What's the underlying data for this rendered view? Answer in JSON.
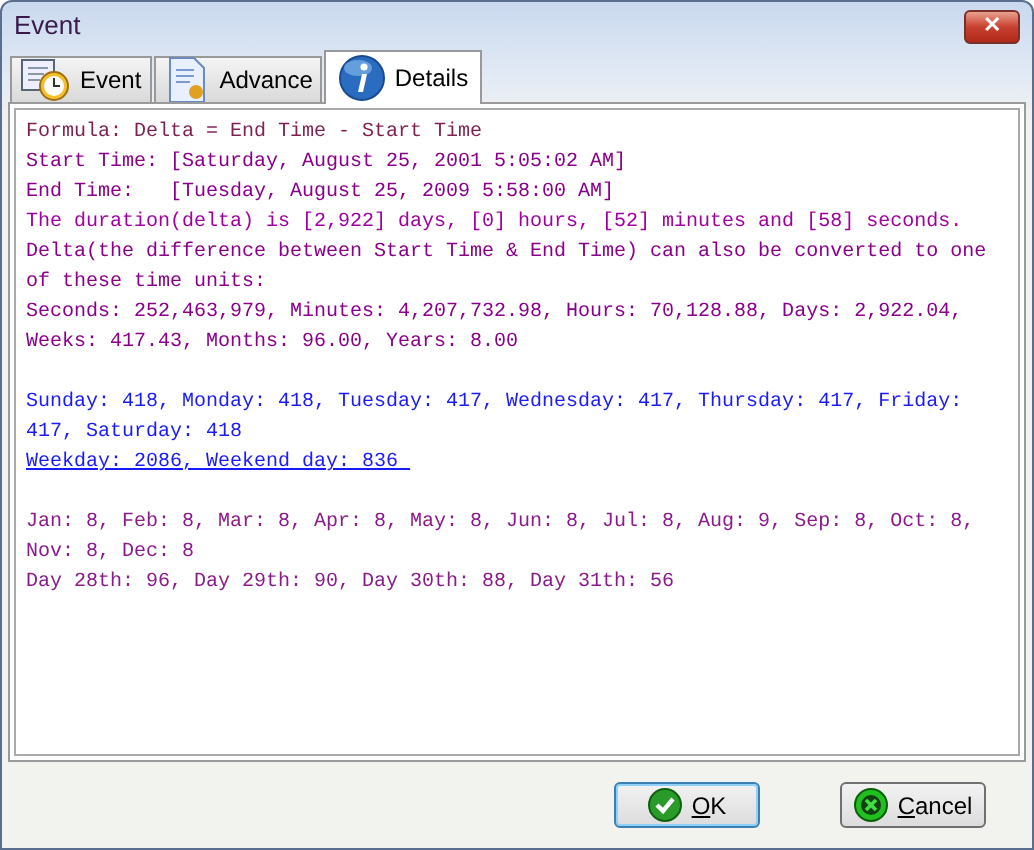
{
  "window": {
    "title": "Event",
    "close_glyph": "✕"
  },
  "tabs": [
    {
      "label": "Event",
      "kind": "event",
      "selected": false
    },
    {
      "label": "Advance",
      "kind": "advance",
      "selected": false
    },
    {
      "label": "Details",
      "kind": "details",
      "selected": true
    }
  ],
  "details": {
    "groups": [
      {
        "lines": [
          {
            "text": "Formula: Delta = End Time - Start Time",
            "color": "#7f1f4f",
            "underline": false
          },
          {
            "text": "Start Time: [Saturday, August 25, 2001 5:05:02 AM]",
            "color": "#8b008b",
            "underline": false
          },
          {
            "text": "End Time:   [Tuesday, August 25, 2009 5:58:00 AM]",
            "color": "#8b008b",
            "underline": false
          },
          {
            "text": "The duration(delta) is [2,922] days, [0] hours, [52] minutes and [58] seconds.",
            "color": "#a000a0",
            "underline": false
          },
          {
            "text": "Delta(the difference between Start Time & End Time) can also be converted to one",
            "color": "#8b008b",
            "underline": false
          },
          {
            "text": "of these time units:",
            "color": "#8b008b",
            "underline": false
          },
          {
            "text": "Seconds: 252,463,979, Minutes: 4,207,732.98, Hours: 70,128.88, Days: 2,922.04,",
            "color": "#8b008b",
            "underline": false
          },
          {
            "text": "Weeks: 417.43, Months: 96.00, Years: 8.00",
            "color": "#8b008b",
            "underline": false
          }
        ]
      },
      {
        "lines": [
          {
            "text": "Sunday: 418, Monday: 418, Tuesday: 417, Wednesday: 417, Thursday: 417, Friday:",
            "color": "#1a1aff",
            "underline": false
          },
          {
            "text": "417, Saturday: 418",
            "color": "#1a1aff",
            "underline": false
          },
          {
            "text": "Weekday: 2086, Weekend day: 836 ",
            "color": "#1a1aff",
            "underline": true
          }
        ]
      },
      {
        "lines": [
          {
            "text": "Jan: 8, Feb: 8, Mar: 8, Apr: 8, May: 8, Jun: 8, Jul: 8, Aug: 9, Sep: 8, Oct: 8,",
            "color": "#8b1a8b",
            "underline": false
          },
          {
            "text": "Nov: 8, Dec: 8",
            "color": "#8b1a8b",
            "underline": false
          },
          {
            "text": "Day 28th: 96, Day 29th: 90, Day 30th: 88, Day 31th: 56",
            "color": "#8b1a8b",
            "underline": false
          }
        ]
      }
    ]
  },
  "buttons": [
    {
      "label": "**O**K",
      "kind": "ok"
    },
    {
      "label": "**C**ancel",
      "kind": "cancel"
    }
  ]
}
